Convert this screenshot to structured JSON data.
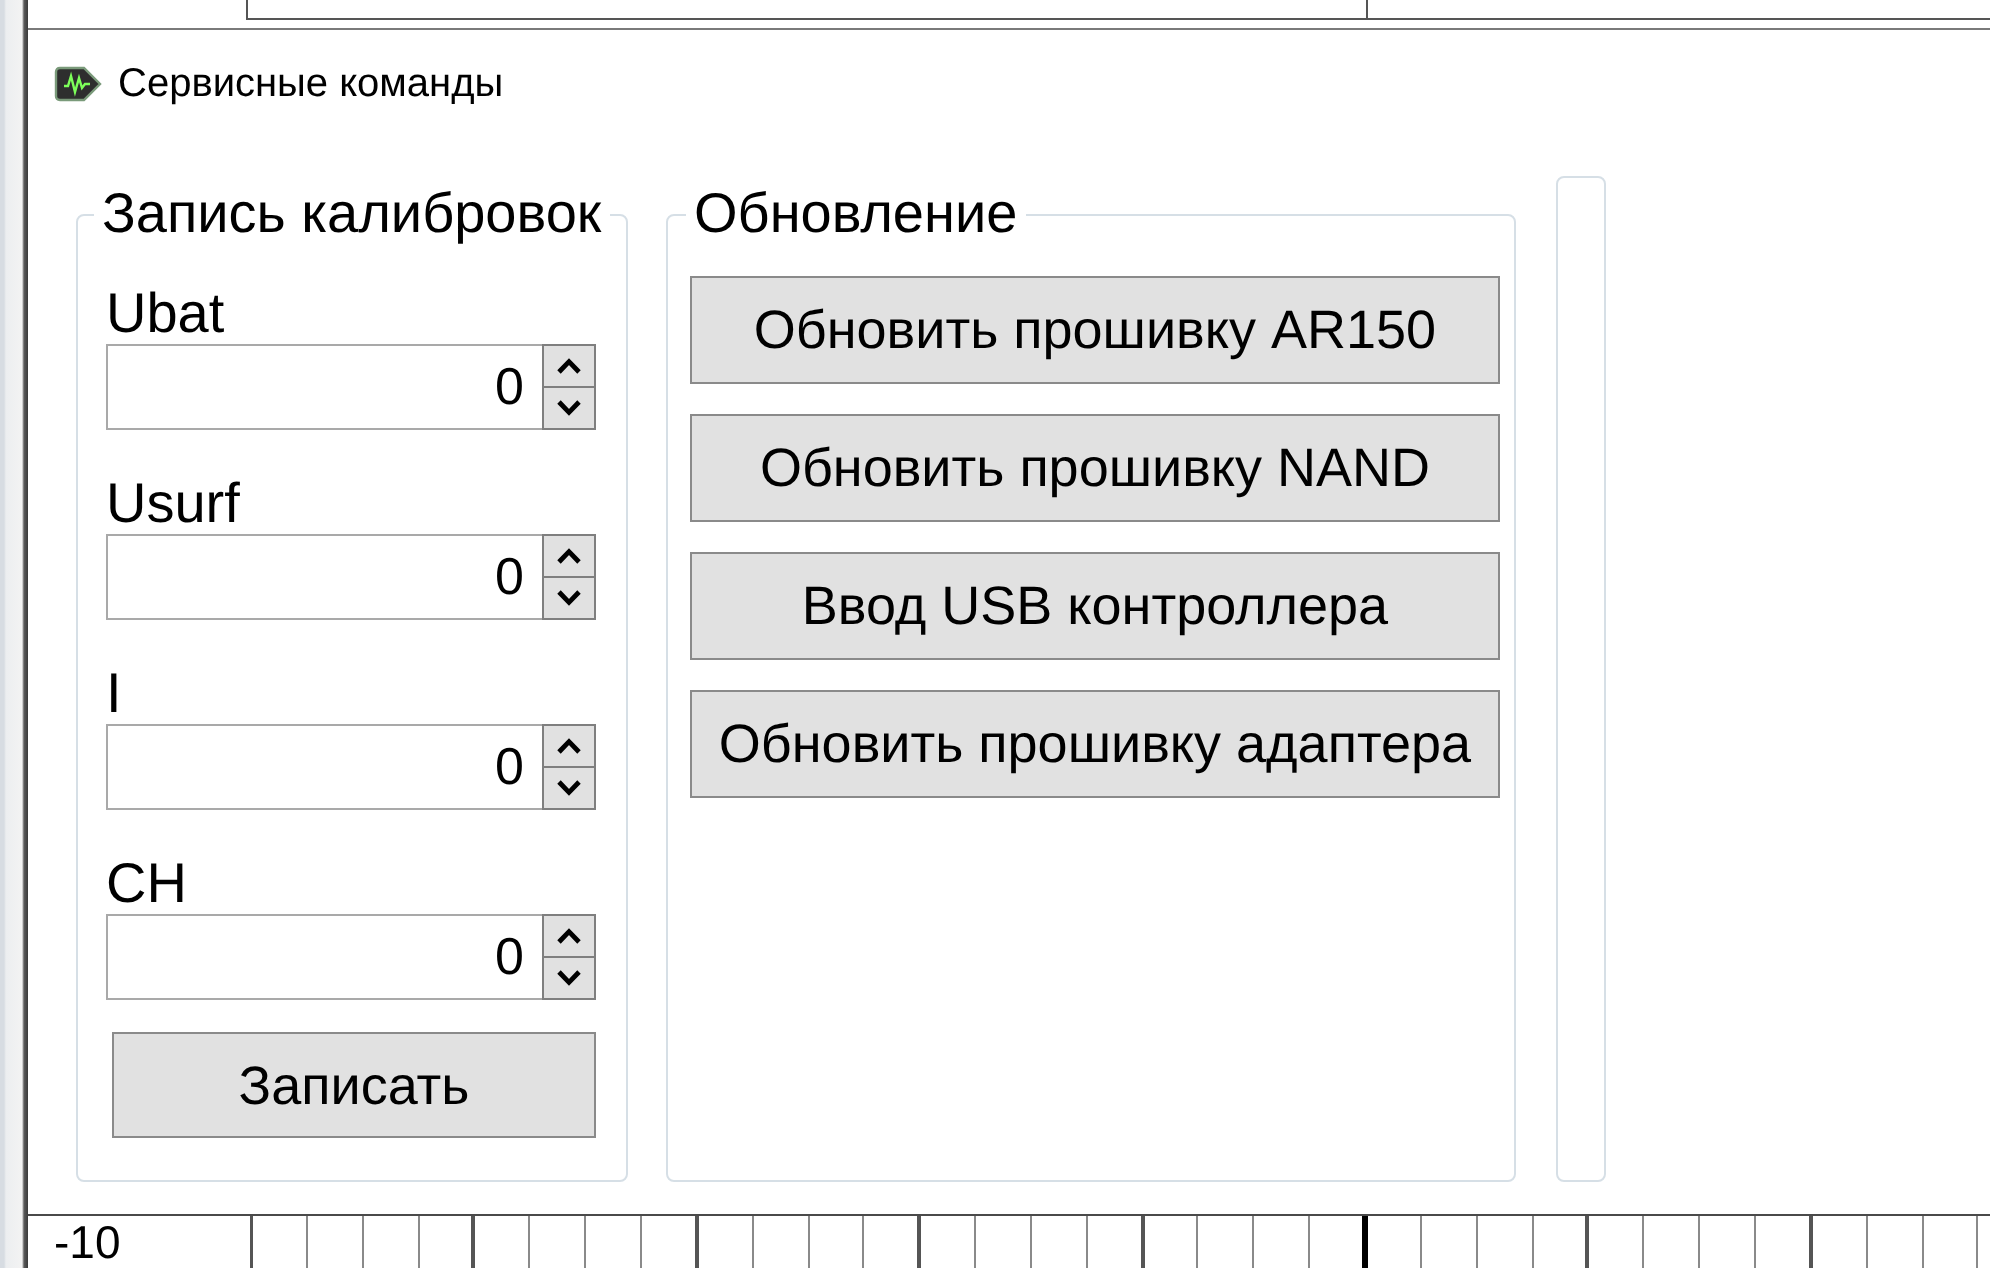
{
  "background": {
    "axis_label": "-10"
  },
  "window": {
    "title": "Сервисные команды"
  },
  "calibration": {
    "title": "Запись калибровок",
    "fields": [
      {
        "label": "Ubat",
        "value": "0"
      },
      {
        "label": "Usurf",
        "value": "0"
      },
      {
        "label": "I",
        "value": "0"
      },
      {
        "label": "CH",
        "value": "0"
      }
    ],
    "button": "Записать"
  },
  "update": {
    "title": "Обновление",
    "buttons": [
      "Обновить прошивку AR150",
      "Обновить прошивку NAND",
      "Ввод USB контроллера",
      "Обновить прошивку адаптера"
    ]
  }
}
